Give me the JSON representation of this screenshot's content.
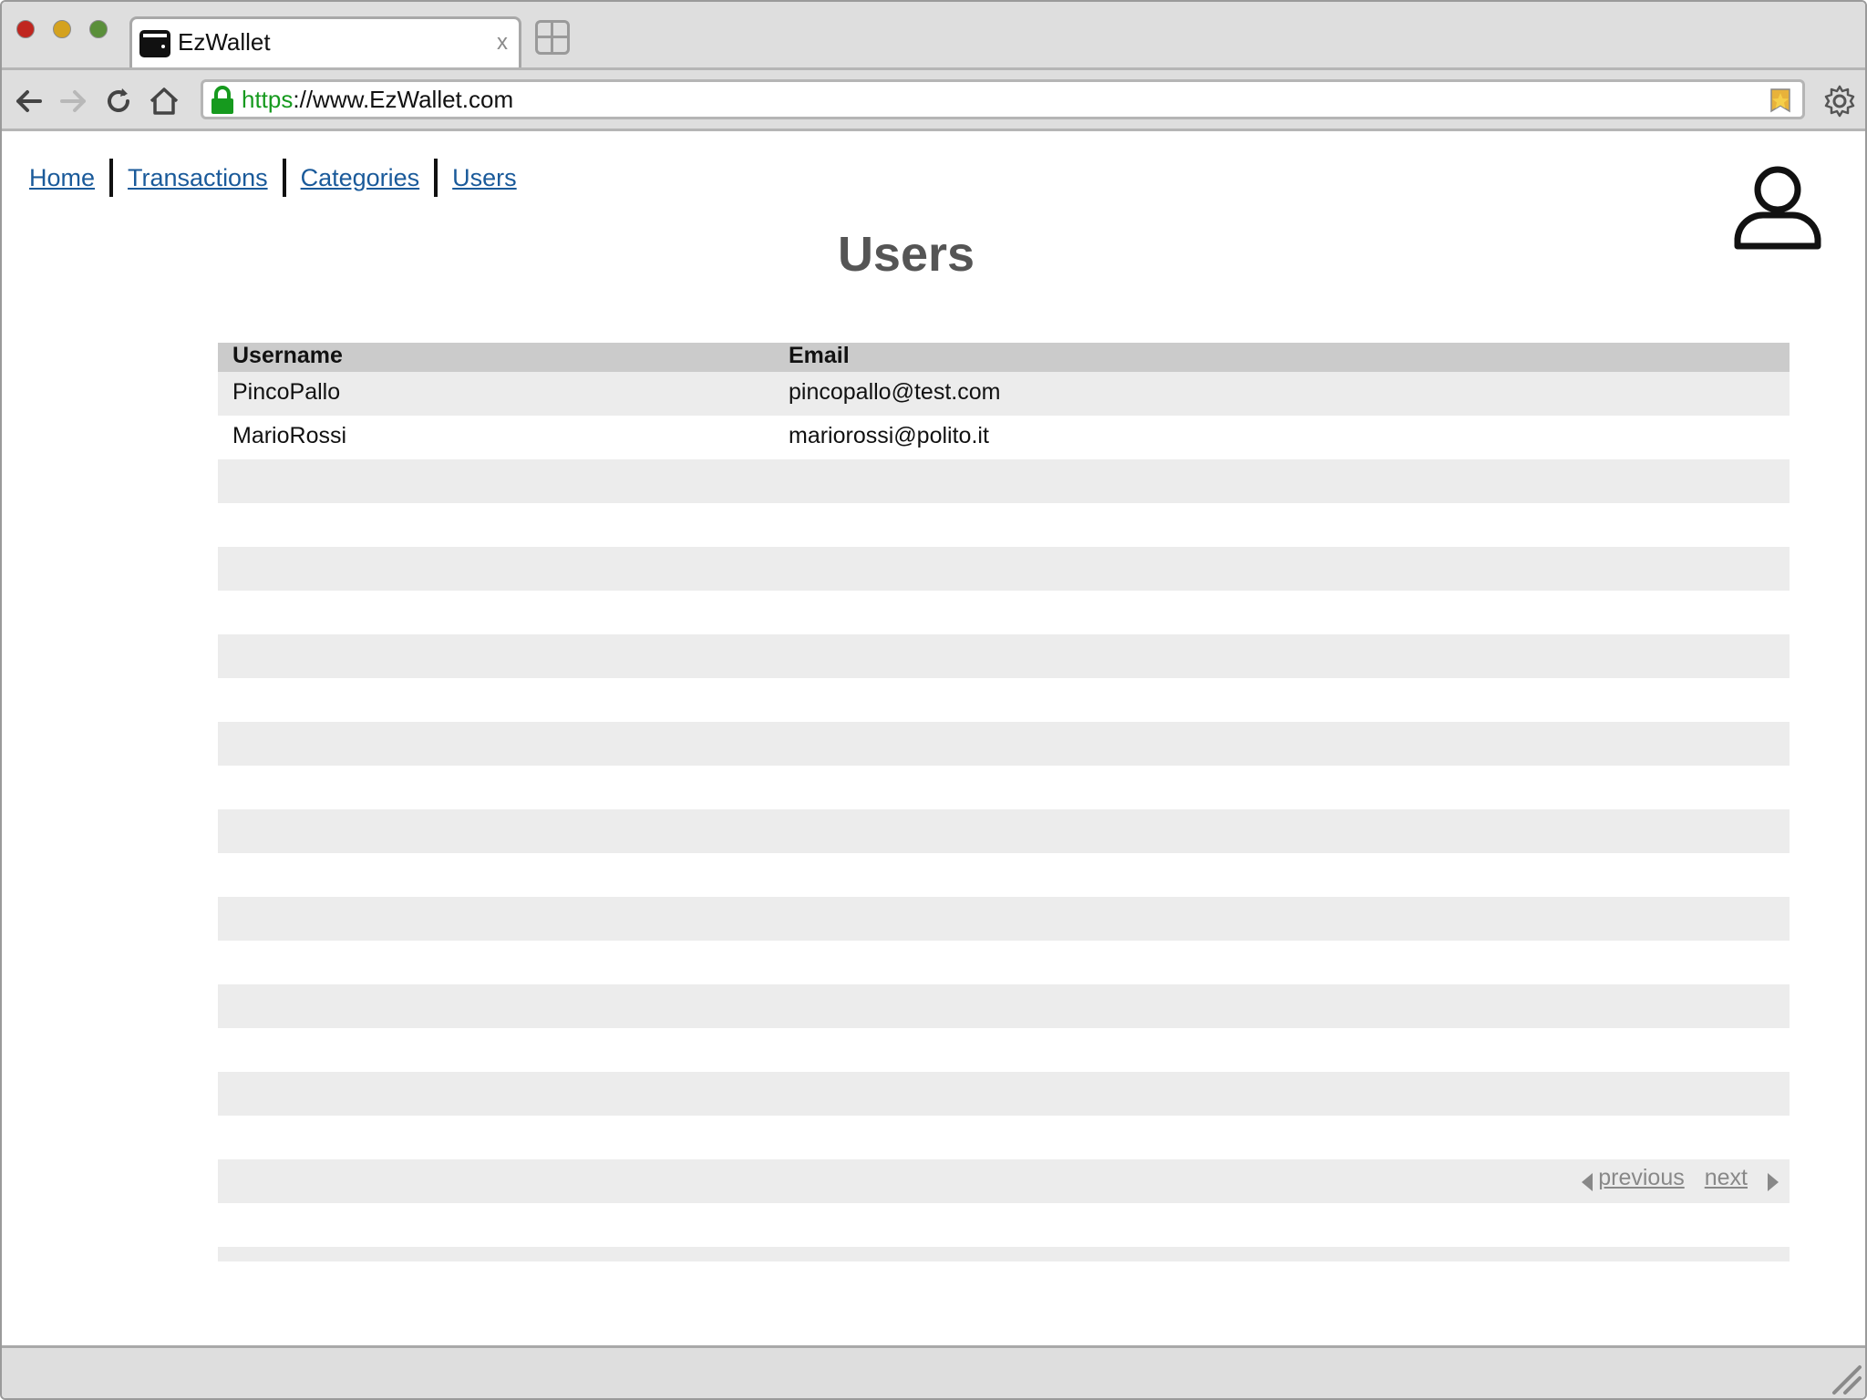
{
  "browser": {
    "tab_title": "EzWallet",
    "tab_close": "x",
    "url_scheme": "https",
    "url_rest": "://www.EzWallet.com"
  },
  "nav": {
    "items": [
      {
        "label": "Home"
      },
      {
        "label": "Transactions"
      },
      {
        "label": "Categories"
      },
      {
        "label": "Users"
      }
    ]
  },
  "page": {
    "title": "Users"
  },
  "table": {
    "columns": [
      "Username",
      "Email"
    ],
    "rows": [
      {
        "username": "PincoPallo",
        "email": "pincopallo@test.com"
      },
      {
        "username": "MarioRossi",
        "email": "mariorossi@polito.it"
      }
    ],
    "empty_row_count": 18
  },
  "pagination": {
    "previous_label": "previous",
    "next_label": "next"
  },
  "colors": {
    "link": "#1a5a9a",
    "secure_green": "#169a1e",
    "header_row": "#cbcbcb",
    "alt_row": "#ececec"
  }
}
